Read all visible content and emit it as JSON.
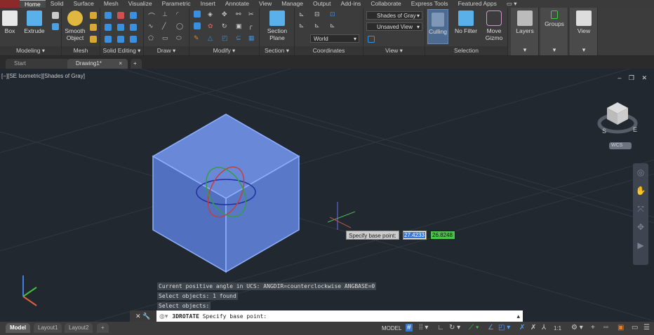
{
  "menu_tabs": [
    "Home",
    "Solid",
    "Surface",
    "Mesh",
    "Visualize",
    "Parametric",
    "Insert",
    "Annotate",
    "View",
    "Manage",
    "Output",
    "Add-ins",
    "Collaborate",
    "Express Tools",
    "Featured Apps"
  ],
  "ribbon": {
    "box": "Box",
    "extrude": "Extrude",
    "smooth_object": "Smooth Object",
    "section_plane": "Section Plane",
    "visual_style": "Shades of Gray",
    "saved_view": "Unsaved View",
    "ucs": "World",
    "culling": "Culling",
    "no_filter": "No Filter",
    "move_gizmo": "Move Gizmo",
    "layers": "Layers",
    "groups": "Groups",
    "view": "View",
    "panels": {
      "modeling": "Modeling ▾",
      "mesh": "Mesh",
      "solid_editing": "Solid Editing ▾",
      "draw": "Draw ▾",
      "modify": "Modify ▾",
      "section": "Section ▾",
      "coordinates": "Coordinates",
      "view": "View ▾",
      "selection": "Selection"
    }
  },
  "doc_tabs": {
    "start": "Start",
    "drawing": "Drawing1*",
    "close": "×",
    "add": "+"
  },
  "viewport": {
    "label": "[−][SE Isometric][Shades of Gray]",
    "wcs": "WCS",
    "window_controls": "– ❐ ✕"
  },
  "dynamic_input": {
    "prompt": "Specify base point:",
    "x": "27.4233",
    "y": "26.8248"
  },
  "command_history": [
    "Current positive angle in UCS:  ANGDIR=counterclockwise  ANGBASE=0",
    "Select objects: 1 found",
    "Select objects:"
  ],
  "command_line": {
    "command": "3DROTATE",
    "prompt": "Specify base point:"
  },
  "layout_tabs": [
    "Model",
    "Layout1",
    "Layout2",
    "+"
  ],
  "status": {
    "model": "MODEL",
    "scale": "1:1"
  },
  "colors": {
    "viewport": "#212830",
    "cube": "#5a78c8",
    "cube_edge": "#8fb0ff",
    "accent": "#4a90e2"
  }
}
